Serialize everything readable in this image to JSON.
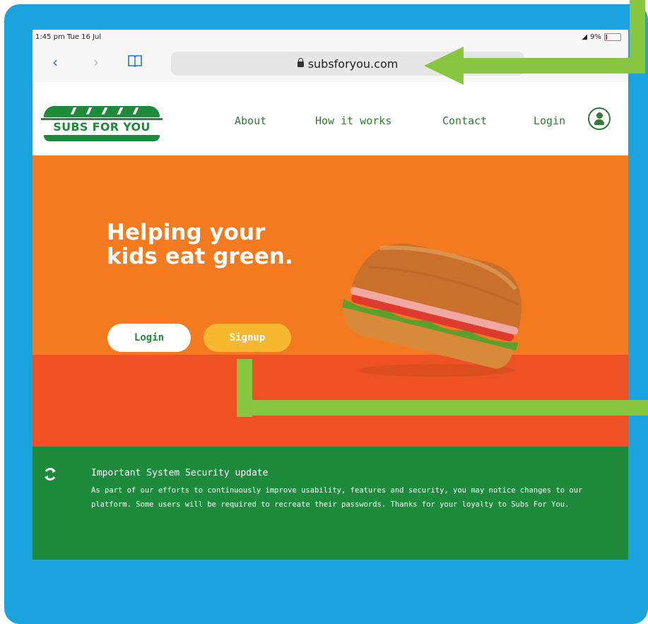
{
  "status_bar": {
    "time": "1:45 pm  Tue 16 Jul",
    "battery": "9%",
    "battery_level": 0.09
  },
  "browser": {
    "url": "subsforyou.com",
    "back_icon": "chevron-left-icon",
    "forward_icon": "chevron-right-icon",
    "bookmarks_icon": "book-icon"
  },
  "site": {
    "logo_text": "SUBS FOR YOU",
    "nav": {
      "about": "About",
      "how_it_works": "How it works",
      "contact": "Contact",
      "login": "Login"
    },
    "avatar_icon": "user-icon"
  },
  "hero": {
    "headline_line1": "Helping your",
    "headline_line2": "kids eat green.",
    "login_label": "Login",
    "signup_label": "Signup"
  },
  "notice": {
    "icon": "refresh-icon",
    "title": "Important System Security update",
    "body": "As part of our efforts to continuously improve usability, features and security, you may notice changes to our platform. Some users will be required to recreate their passwords. Thanks for your loyalty to Subs For You."
  },
  "colors": {
    "frame": "#1aa3dc",
    "orange": "#f47a20",
    "red": "#ee5123",
    "green": "#1e8a3c",
    "signup": "#f6b82e",
    "arrow": "#88c540"
  }
}
